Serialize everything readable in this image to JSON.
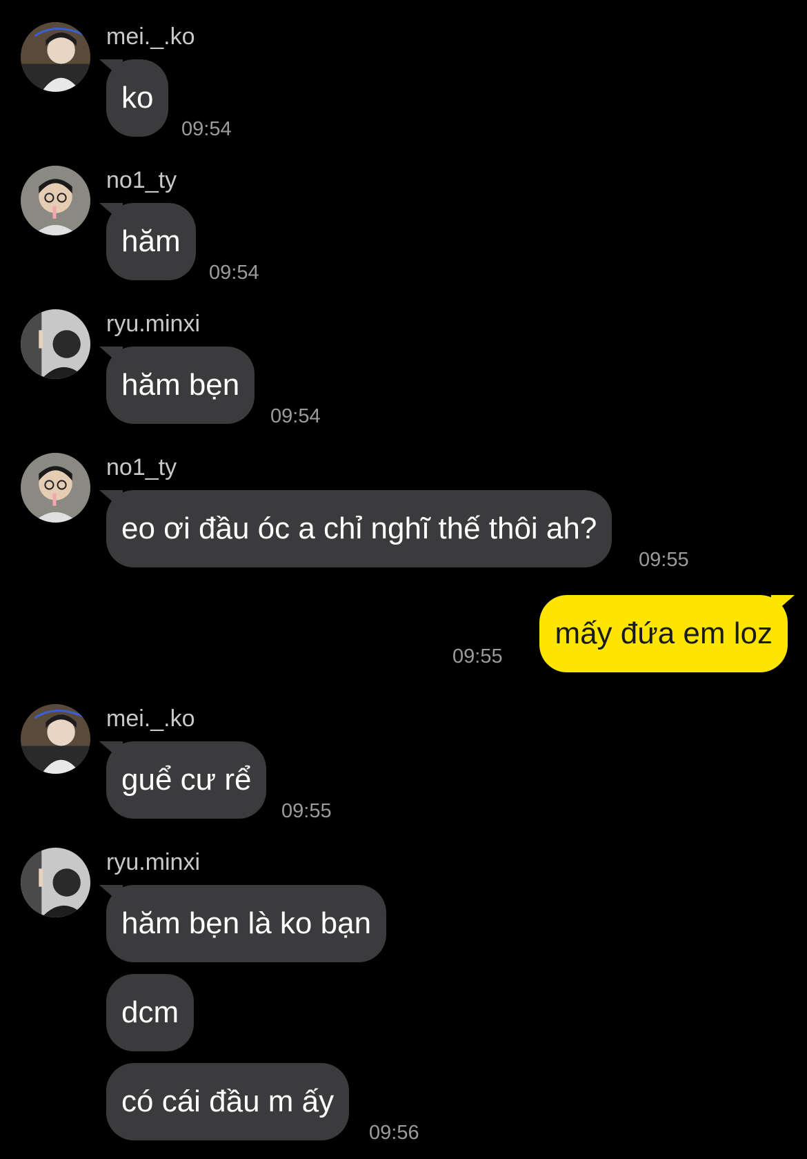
{
  "messages": [
    {
      "sender": "mei._.ko",
      "avatar": "avatar-mei",
      "text": "ko",
      "time": "09:54"
    },
    {
      "sender": "no1_ty",
      "avatar": "avatar-no1",
      "text": "hăm",
      "time": "09:54"
    },
    {
      "sender": "ryu.minxi",
      "avatar": "avatar-ryu",
      "text": "hăm bẹn",
      "time": "09:54"
    },
    {
      "sender": "no1_ty",
      "avatar": "avatar-no1",
      "text": "eo ơi đầu óc a chỉ nghĩ thế thôi ah?",
      "time": "09:55"
    },
    {
      "sender": "me",
      "text": "mấy đứa em loz",
      "time": "09:55"
    },
    {
      "sender": "mei._.ko",
      "avatar": "avatar-mei",
      "text": "guể cư rể",
      "time": "09:55"
    },
    {
      "sender": "ryu.minxi",
      "avatar": "avatar-ryu",
      "texts": [
        "hăm bẹn là ko bạn",
        "dcm",
        "có cái đầu m ấy"
      ],
      "time": "09:56"
    }
  ],
  "colors": {
    "background": "#000000",
    "incoming_bubble": "#3b3b3d",
    "outgoing_bubble": "#fee500",
    "sender_name": "#c9c9c9",
    "timestamp": "#9b9b9b"
  }
}
